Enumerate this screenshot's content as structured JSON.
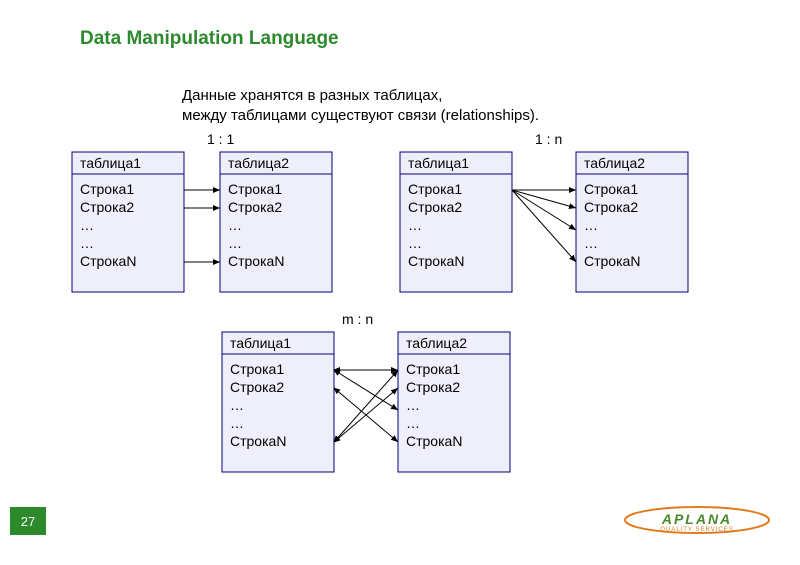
{
  "title": "Data Manipulation Language",
  "description_line1": "Данные хранятся в разных таблицах,",
  "description_line2": "между таблицами существуют связи (relationships).",
  "labels": {
    "one_to_one": "1 : 1",
    "one_to_many": "1 : n",
    "many_to_many": "m : n"
  },
  "tables": {
    "header1": "таблица1",
    "header2": "таблица2",
    "rows": [
      "Строка1",
      "Строка2",
      "…",
      "…",
      "СтрокаN"
    ]
  },
  "page_number": "27",
  "logo": {
    "brand": "APLANA",
    "tagline": "QUALITY  SERVICES"
  }
}
